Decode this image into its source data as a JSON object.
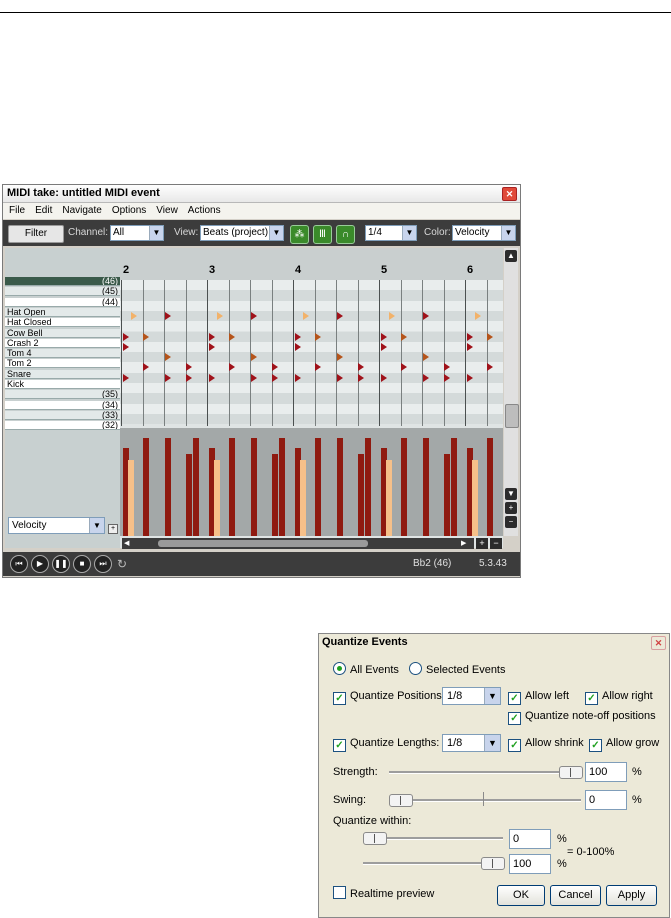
{
  "midi_window": {
    "title": "MIDI take: untitled MIDI event",
    "menu": [
      "File",
      "Edit",
      "Navigate",
      "Options",
      "View",
      "Actions"
    ],
    "toolbar": {
      "filter_label": "Filter",
      "channel_label": "Channel:",
      "channel_value": "All",
      "view_label": "View:",
      "view_value": "Beats (project)",
      "grid_value": "1/4",
      "color_label": "Color:",
      "color_value": "Velocity"
    },
    "keys": [
      {
        "label": "(46)",
        "type": "num",
        "selected": true
      },
      {
        "label": "(45)",
        "type": "num"
      },
      {
        "label": "(44)",
        "type": "num"
      },
      {
        "label": "Hat Open",
        "type": "name"
      },
      {
        "label": "Hat Closed",
        "type": "name"
      },
      {
        "label": "Cow Bell",
        "type": "name"
      },
      {
        "label": "Crash 2",
        "type": "name"
      },
      {
        "label": "Tom 4",
        "type": "name"
      },
      {
        "label": "Tom 2",
        "type": "name"
      },
      {
        "label": "Snare",
        "type": "name"
      },
      {
        "label": "Kick",
        "type": "name"
      },
      {
        "label": "(35)",
        "type": "num"
      },
      {
        "label": "(34)",
        "type": "num"
      },
      {
        "label": "(33)",
        "type": "num"
      },
      {
        "label": "(32)",
        "type": "num"
      }
    ],
    "bars": [
      "2",
      "3",
      "4",
      "5",
      "6"
    ],
    "lane_select": "Velocity",
    "status_note": "Bb2 (46)",
    "status_position": "5.3.43",
    "colors": {
      "note_light": "#f2b26a",
      "note_mid": "#b5541a",
      "note_dark": "#a0121a",
      "vel_dark": "#8f1a10",
      "vel_light": "#f6c089"
    }
  },
  "quantize_dialog": {
    "title": "Quantize Events",
    "all_events": "All Events",
    "selected_events": "Selected Events",
    "quantize_positions": "Quantize Positions:",
    "positions_value": "1/8",
    "allow_left": "Allow left",
    "allow_right": "Allow right",
    "quantize_noteoff": "Quantize note-off positions",
    "quantize_lengths": "Quantize Lengths:",
    "lengths_value": "1/8",
    "allow_shrink": "Allow shrink",
    "allow_grow": "Allow grow",
    "strength_label": "Strength:",
    "strength_value": "100",
    "swing_label": "Swing:",
    "swing_value": "0",
    "within_label": "Quantize within:",
    "within_min": "0",
    "within_max": "100",
    "pct": "%",
    "range_note": "= 0-100%",
    "realtime_preview": "Realtime preview",
    "ok": "OK",
    "cancel": "Cancel",
    "apply": "Apply"
  }
}
